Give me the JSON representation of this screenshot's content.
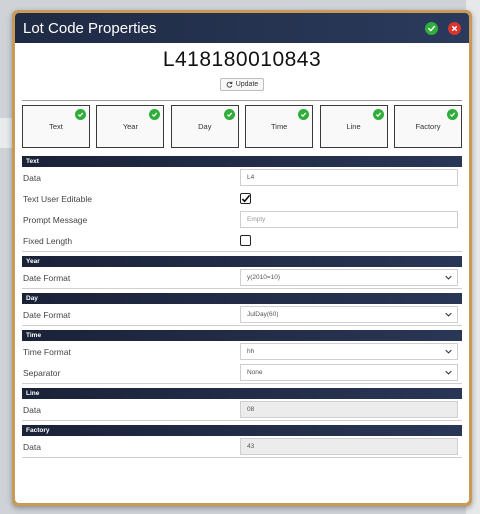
{
  "window": {
    "title": "Lot Code Properties"
  },
  "lot_code": "L418180010843",
  "update_label": "Update",
  "tiles": [
    {
      "label": "Text",
      "checked": true
    },
    {
      "label": "Year",
      "checked": true
    },
    {
      "label": "Day",
      "checked": true
    },
    {
      "label": "Time",
      "checked": true
    },
    {
      "label": "Line",
      "checked": true
    },
    {
      "label": "Factory",
      "checked": true
    }
  ],
  "sections": {
    "text": {
      "header": "Text",
      "data_label": "Data",
      "data_value": "L4",
      "editable_label": "Text User Editable",
      "editable_checked": true,
      "prompt_label": "Prompt Message",
      "prompt_placeholder": "Empty",
      "fixed_label": "Fixed Length",
      "fixed_checked": false
    },
    "year": {
      "header": "Year",
      "format_label": "Date Format",
      "format_value": "y(2010=10)"
    },
    "day": {
      "header": "Day",
      "format_label": "Date Format",
      "format_value": "JulDay(60)"
    },
    "time": {
      "header": "Time",
      "format_label": "Time Format",
      "format_value": "hh",
      "separator_label": "Separator",
      "separator_value": "None"
    },
    "line": {
      "header": "Line",
      "data_label": "Data",
      "data_value": "08"
    },
    "factory": {
      "header": "Factory",
      "data_label": "Data",
      "data_value": "43"
    }
  },
  "colors": {
    "frame": "#c89a55",
    "titlebar": "#1f2a44",
    "check_green": "#2fae3c",
    "close_red": "#d8352e"
  }
}
